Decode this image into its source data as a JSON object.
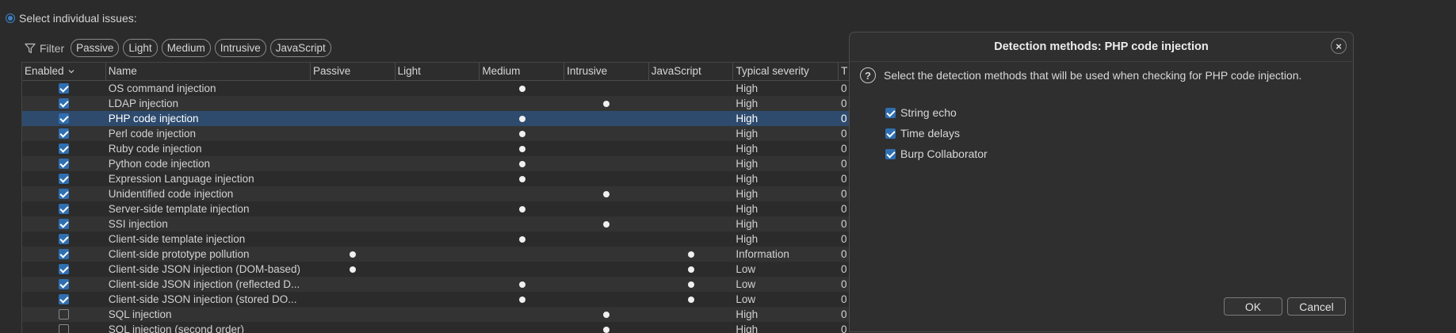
{
  "mode": {
    "label": "Select individual issues:"
  },
  "filter": {
    "label": "Filter",
    "chips": [
      "Passive",
      "Light",
      "Medium",
      "Intrusive",
      "JavaScript"
    ]
  },
  "table": {
    "headers": {
      "enabled": "Enabled",
      "name": "Name",
      "passive": "Passive",
      "light": "Light",
      "medium": "Medium",
      "intrusive": "Intrusive",
      "javascript": "JavaScript",
      "severity": "Typical severity",
      "typical_confidence": "T"
    },
    "rows": [
      {
        "enabled": true,
        "name": "OS command injection",
        "passive": false,
        "light": false,
        "medium": true,
        "intrusive": false,
        "javascript": false,
        "severity": "High",
        "t": "0"
      },
      {
        "enabled": true,
        "name": "LDAP injection",
        "passive": false,
        "light": false,
        "medium": false,
        "intrusive": true,
        "javascript": false,
        "severity": "High",
        "t": "0"
      },
      {
        "enabled": true,
        "name": "PHP code injection",
        "passive": false,
        "light": false,
        "medium": true,
        "intrusive": false,
        "javascript": false,
        "severity": "High",
        "t": "0",
        "selected": true
      },
      {
        "enabled": true,
        "name": "Perl code injection",
        "passive": false,
        "light": false,
        "medium": true,
        "intrusive": false,
        "javascript": false,
        "severity": "High",
        "t": "0"
      },
      {
        "enabled": true,
        "name": "Ruby code injection",
        "passive": false,
        "light": false,
        "medium": true,
        "intrusive": false,
        "javascript": false,
        "severity": "High",
        "t": "0"
      },
      {
        "enabled": true,
        "name": "Python code injection",
        "passive": false,
        "light": false,
        "medium": true,
        "intrusive": false,
        "javascript": false,
        "severity": "High",
        "t": "0"
      },
      {
        "enabled": true,
        "name": "Expression Language injection",
        "passive": false,
        "light": false,
        "medium": true,
        "intrusive": false,
        "javascript": false,
        "severity": "High",
        "t": "0"
      },
      {
        "enabled": true,
        "name": "Unidentified code injection",
        "passive": false,
        "light": false,
        "medium": false,
        "intrusive": true,
        "javascript": false,
        "severity": "High",
        "t": "0"
      },
      {
        "enabled": true,
        "name": "Server-side template injection",
        "passive": false,
        "light": false,
        "medium": true,
        "intrusive": false,
        "javascript": false,
        "severity": "High",
        "t": "0"
      },
      {
        "enabled": true,
        "name": "SSI injection",
        "passive": false,
        "light": false,
        "medium": false,
        "intrusive": true,
        "javascript": false,
        "severity": "High",
        "t": "0"
      },
      {
        "enabled": true,
        "name": "Client-side template injection",
        "passive": false,
        "light": false,
        "medium": true,
        "intrusive": false,
        "javascript": false,
        "severity": "High",
        "t": "0"
      },
      {
        "enabled": true,
        "name": "Client-side prototype pollution",
        "passive": true,
        "light": false,
        "medium": false,
        "intrusive": false,
        "javascript": true,
        "severity": "Information",
        "t": "0"
      },
      {
        "enabled": true,
        "name": "Client-side JSON injection (DOM-based)",
        "passive": true,
        "light": false,
        "medium": false,
        "intrusive": false,
        "javascript": true,
        "severity": "Low",
        "t": "0"
      },
      {
        "enabled": true,
        "name": "Client-side JSON injection (reflected D...",
        "passive": false,
        "light": false,
        "medium": true,
        "intrusive": false,
        "javascript": true,
        "severity": "Low",
        "t": "0"
      },
      {
        "enabled": true,
        "name": "Client-side JSON injection (stored DO...",
        "passive": false,
        "light": false,
        "medium": true,
        "intrusive": false,
        "javascript": true,
        "severity": "Low",
        "t": "0"
      },
      {
        "enabled": false,
        "name": "SQL injection",
        "passive": false,
        "light": false,
        "medium": false,
        "intrusive": true,
        "javascript": false,
        "severity": "High",
        "t": "0"
      },
      {
        "enabled": false,
        "name": "SQL injection (second order)",
        "passive": false,
        "light": false,
        "medium": false,
        "intrusive": true,
        "javascript": false,
        "severity": "High",
        "t": "0"
      }
    ]
  },
  "dialog": {
    "title": "Detection methods: PHP code injection",
    "description": "Select the detection methods that will be used when checking for PHP code injection.",
    "options": [
      {
        "label": "String echo",
        "checked": true
      },
      {
        "label": "Time delays",
        "checked": true
      },
      {
        "label": "Burp Collaborator",
        "checked": true
      }
    ],
    "ok_label": "OK",
    "cancel_label": "Cancel",
    "close_glyph": "×",
    "help_glyph": "?"
  },
  "icons": {
    "filter": "filter-funnel-icon",
    "sort": "chevron-down-icon",
    "help": "question-circle-icon",
    "close": "close-icon"
  }
}
